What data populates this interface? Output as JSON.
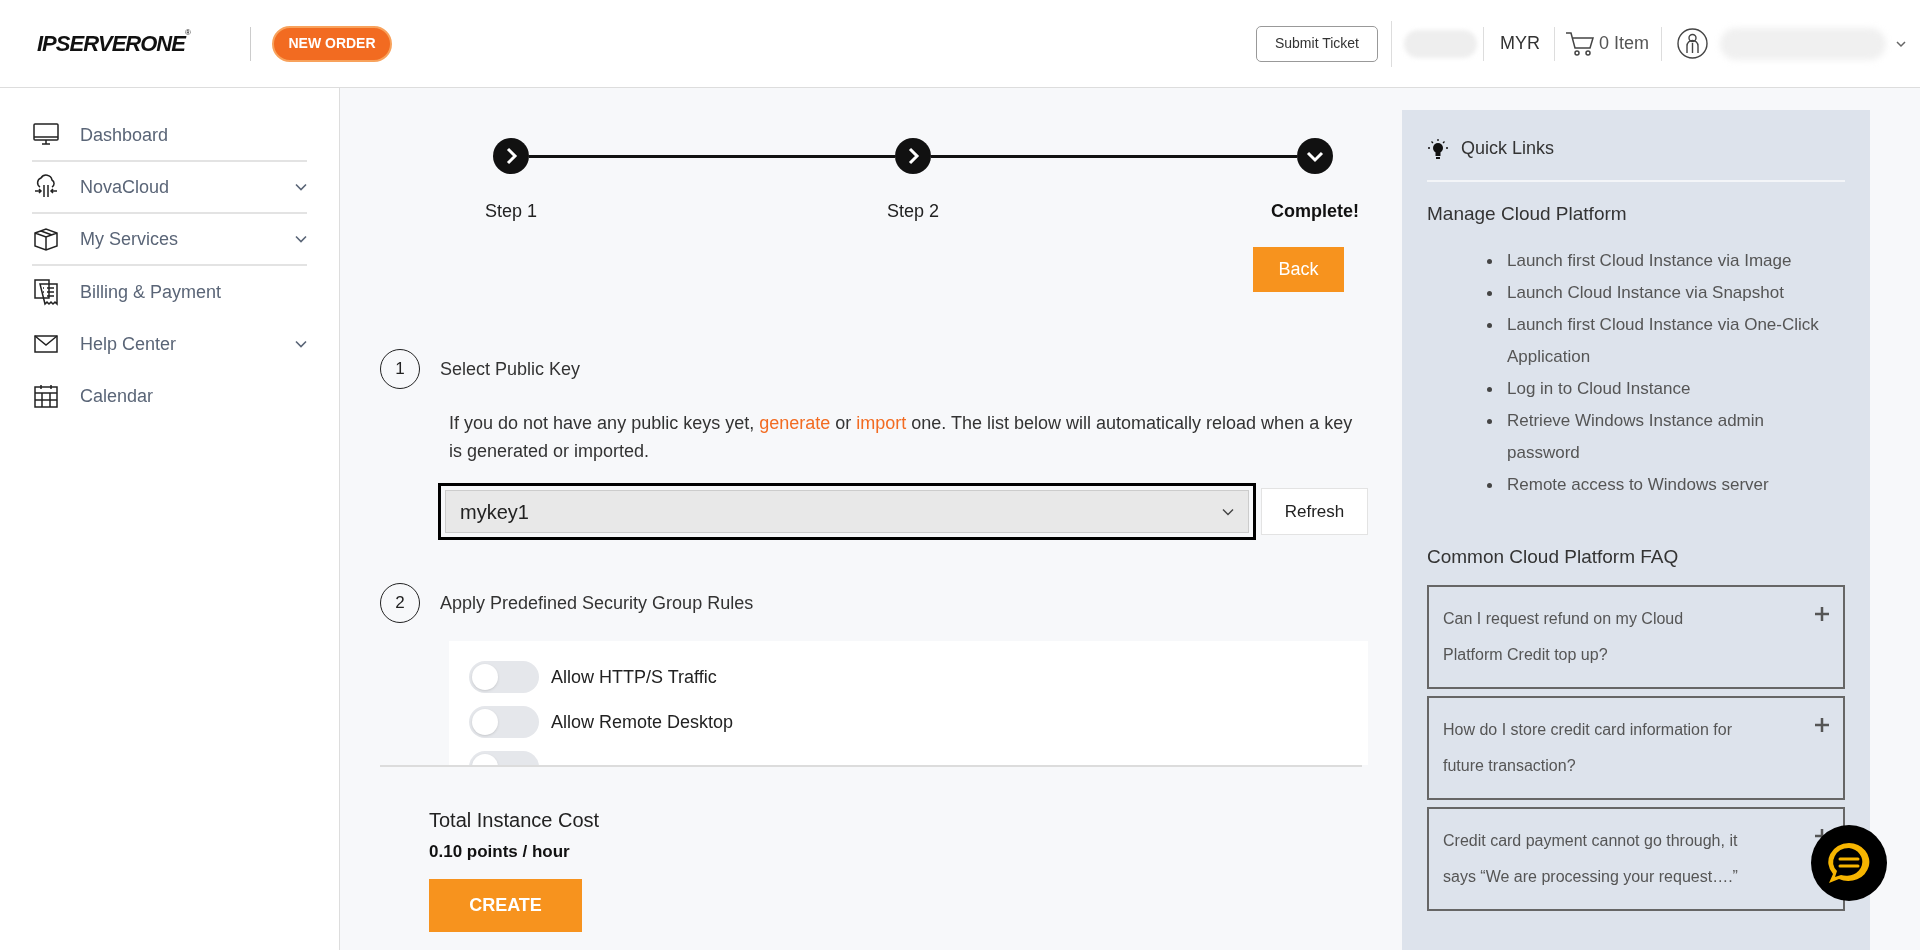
{
  "header": {
    "logo": {
      "text": "IPSERVERONE",
      "mark": "®"
    },
    "new_order": "NEW ORDER",
    "submit_ticket": "Submit Ticket",
    "currency": "MYR",
    "cart": "0 Item"
  },
  "sidebar": {
    "items": [
      {
        "label": "Dashboard",
        "expandable": false,
        "divider": true
      },
      {
        "label": "NovaCloud",
        "expandable": true,
        "divider": true
      },
      {
        "label": "My Services",
        "expandable": true,
        "divider": true
      },
      {
        "label": "Billing & Payment",
        "expandable": false,
        "divider": false
      },
      {
        "label": "Help Center",
        "expandable": true,
        "divider": false
      },
      {
        "label": "Calendar",
        "expandable": false,
        "divider": false
      }
    ]
  },
  "stepper": {
    "steps": [
      {
        "label": "Step 1",
        "selected": false
      },
      {
        "label": "Step 2",
        "selected": false
      },
      {
        "label": "Complete!",
        "selected": true
      }
    ],
    "back": "Back"
  },
  "sections": [
    {
      "number": "1",
      "title": "Select Public Key",
      "paragraph": [
        {
          "text": "If you do not have any public keys yet, "
        },
        {
          "text": "generate",
          "link": true
        },
        {
          "text": " or "
        },
        {
          "text": "import",
          "link": true
        },
        {
          "text": " one. The list below will automatically reload when a key is generated or imported."
        }
      ],
      "select": {
        "value": "mykey1"
      },
      "refresh": "Refresh"
    },
    {
      "number": "2",
      "title": "Apply Predefined Security Group Rules",
      "rules": [
        {
          "label": "Allow HTTP/S Traffic",
          "on": false
        },
        {
          "label": "Allow Remote Desktop",
          "on": false
        },
        {
          "on": false
        }
      ]
    }
  ],
  "footer": {
    "cost_label": "Total Instance Cost",
    "cost_value": "0.10 points / hour",
    "create": "CREATE"
  },
  "quick_links": {
    "title": "Quick Links",
    "manage_heading": "Manage Cloud Platform",
    "links": [
      "Launch first Cloud Instance via Image",
      "Launch Cloud Instance via Snapshot",
      "Launch first Cloud Instance via One-Click Application",
      "Log in to Cloud Instance",
      "Retrieve Windows Instance admin password",
      "Remote access to Windows server"
    ],
    "faq_heading": "Common Cloud Platform FAQ",
    "faq": [
      {
        "question": "Can I request refund on my Cloud Platform Credit top up?",
        "expanded": false
      },
      {
        "question": "How do I store credit card information for future transaction?",
        "expanded": false
      },
      {
        "question": "Credit card payment cannot go through, it says “We are processing your request….”",
        "expanded": false
      }
    ]
  }
}
